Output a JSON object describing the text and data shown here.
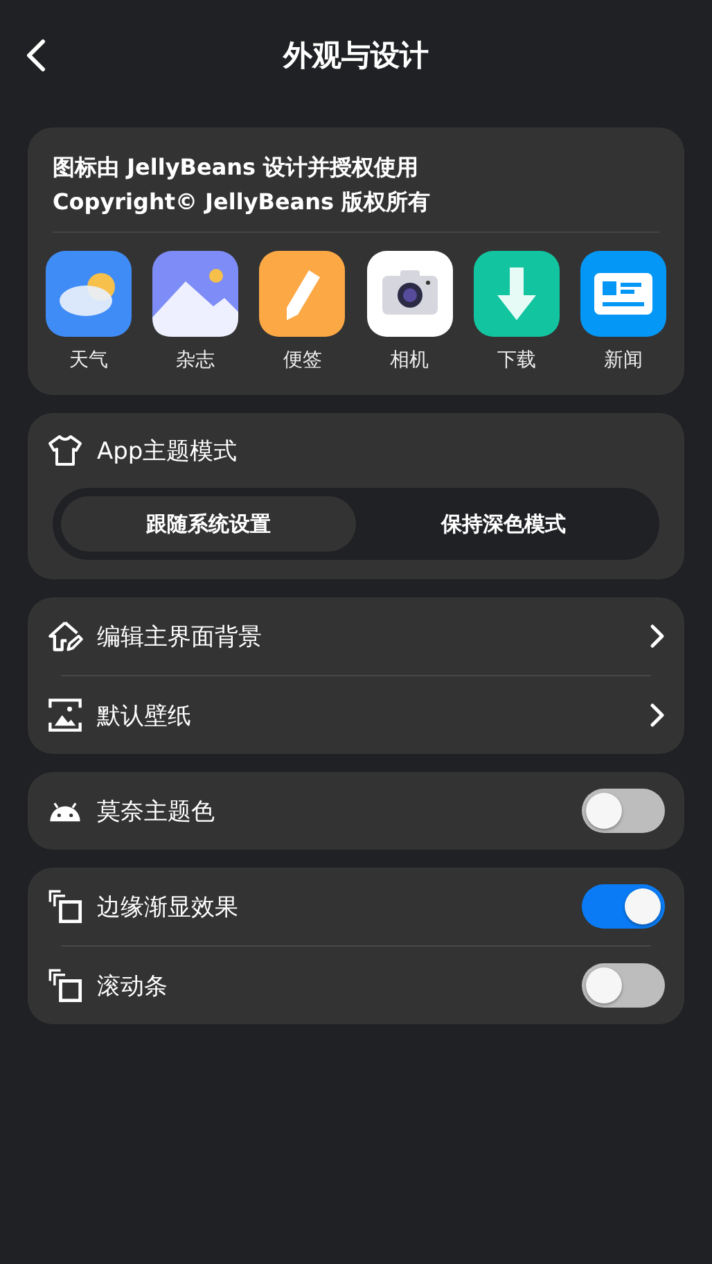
{
  "header": {
    "title": "外观与设计"
  },
  "credits": {
    "lines": [
      "图标由 JellyBeans 设计并授权使用",
      "Copyright© JellyBeans 版权所有"
    ],
    "apps": [
      {
        "kind": "weather",
        "label": "天气"
      },
      {
        "kind": "magazine",
        "label": "杂志"
      },
      {
        "kind": "notes",
        "label": "便签"
      },
      {
        "kind": "camera",
        "label": "相机"
      },
      {
        "kind": "download",
        "label": "下载"
      },
      {
        "kind": "news",
        "label": "新闻"
      }
    ]
  },
  "theme_mode": {
    "label": "App主题模式",
    "options": [
      {
        "label": "跟随系统设置",
        "selected": true
      },
      {
        "label": "保持深色模式",
        "selected": false
      }
    ]
  },
  "groups": [
    [
      {
        "kind": "link",
        "label": "编辑主界面背景"
      },
      {
        "kind": "link",
        "label": "默认壁纸"
      }
    ],
    [
      {
        "kind": "toggle",
        "label": "莫奈主题色",
        "on": false
      }
    ],
    [
      {
        "kind": "toggle",
        "label": "边缘渐显效果",
        "on": true
      },
      {
        "kind": "toggle",
        "label": "滚动条",
        "on": false
      }
    ]
  ]
}
